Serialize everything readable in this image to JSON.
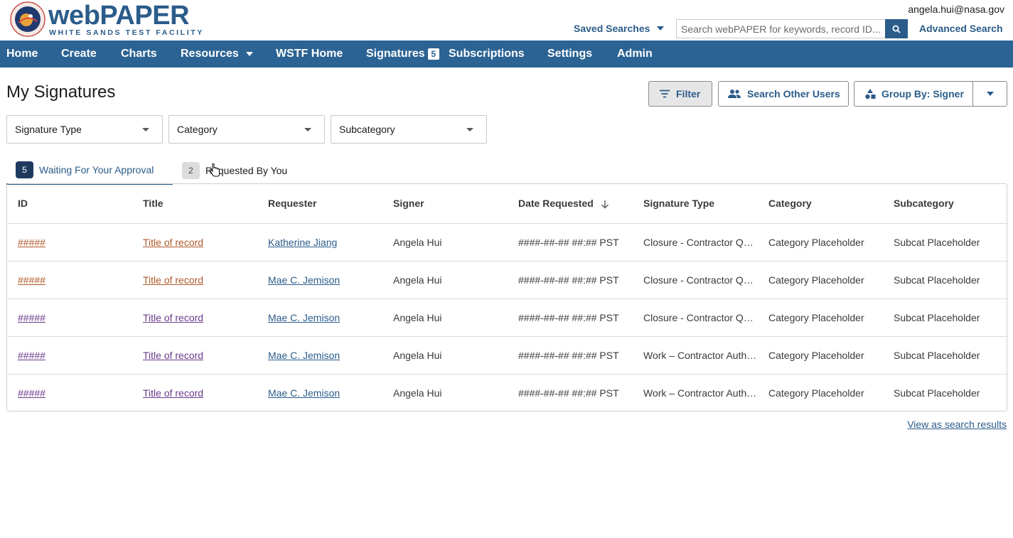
{
  "header": {
    "logo_word": "webPAPER",
    "logo_sub": "WHITE SANDS TEST FACILITY",
    "user_email": "angela.hui@nasa.gov",
    "saved_searches": "Saved Searches",
    "search_placeholder": "Search webPAPER for keywords, record ID...",
    "advanced_search": "Advanced Search"
  },
  "nav": {
    "items": [
      {
        "label": "Home"
      },
      {
        "label": "Create"
      },
      {
        "label": "Charts"
      },
      {
        "label": "Resources"
      },
      {
        "label": "WSTF Home"
      },
      {
        "label": "Signatures",
        "badge": "5"
      },
      {
        "label": "Subscriptions"
      },
      {
        "label": "Settings"
      },
      {
        "label": "Admin"
      }
    ]
  },
  "page": {
    "title": "My Signatures",
    "filter_label": "Filter",
    "search_users_label": "Search Other Users",
    "group_by_label": "Group By: Signer"
  },
  "filters": {
    "signature_type": "Signature Type",
    "category": "Category",
    "subcategory": "Subcategory"
  },
  "tabs": [
    {
      "count": "5",
      "label": "Waiting For Your Approval",
      "active": true
    },
    {
      "count": "2",
      "label": "Requested By You",
      "active": false
    }
  ],
  "table": {
    "columns": [
      "ID",
      "Title",
      "Requester",
      "Signer",
      "Date Requested",
      "Signature Type",
      "Category",
      "Subcategory"
    ],
    "rows": [
      {
        "id": "#####",
        "title": "Title of record",
        "requester": "Katherine Jiang",
        "signer": "Angela Hui",
        "date": "####-##-## ##:## PST",
        "sig_type": "Closure - Contractor Qua...",
        "category": "Category Placeholder",
        "subcategory": "Subcat Placeholder",
        "link_color": "orange"
      },
      {
        "id": "#####",
        "title": "Title of record",
        "requester": "Mae C. Jemison",
        "signer": "Angela Hui",
        "date": "####-##-## ##:## PST",
        "sig_type": "Closure - Contractor Qua...",
        "category": "Category Placeholder",
        "subcategory": "Subcat Placeholder",
        "link_color": "orange"
      },
      {
        "id": "#####",
        "title": "Title of record",
        "requester": "Mae C. Jemison",
        "signer": "Angela Hui",
        "date": "####-##-## ##:## PST",
        "sig_type": "Closure - Contractor Qua...",
        "category": "Category Placeholder",
        "subcategory": "Subcat Placeholder",
        "link_color": "purple"
      },
      {
        "id": "#####",
        "title": "Title of record",
        "requester": "Mae C. Jemison",
        "signer": "Angela Hui",
        "date": "####-##-## ##:## PST",
        "sig_type": "Work – Contractor Autho...",
        "category": "Category Placeholder",
        "subcategory": "Subcat Placeholder",
        "link_color": "purple"
      },
      {
        "id": "#####",
        "title": "Title of record",
        "requester": "Mae C. Jemison",
        "signer": "Angela Hui",
        "date": "####-##-## ##:## PST",
        "sig_type": "Work – Contractor Autho...",
        "category": "Category Placeholder",
        "subcategory": "Subcat Placeholder",
        "link_color": "purple"
      }
    ]
  },
  "footer": {
    "view_as_search": "View as search results"
  },
  "colors": {
    "brand": "#2b5c8a",
    "nav_bg": "#2b6394",
    "visited_orange": "#b05a2a",
    "visited_purple": "#6a3a8a"
  }
}
